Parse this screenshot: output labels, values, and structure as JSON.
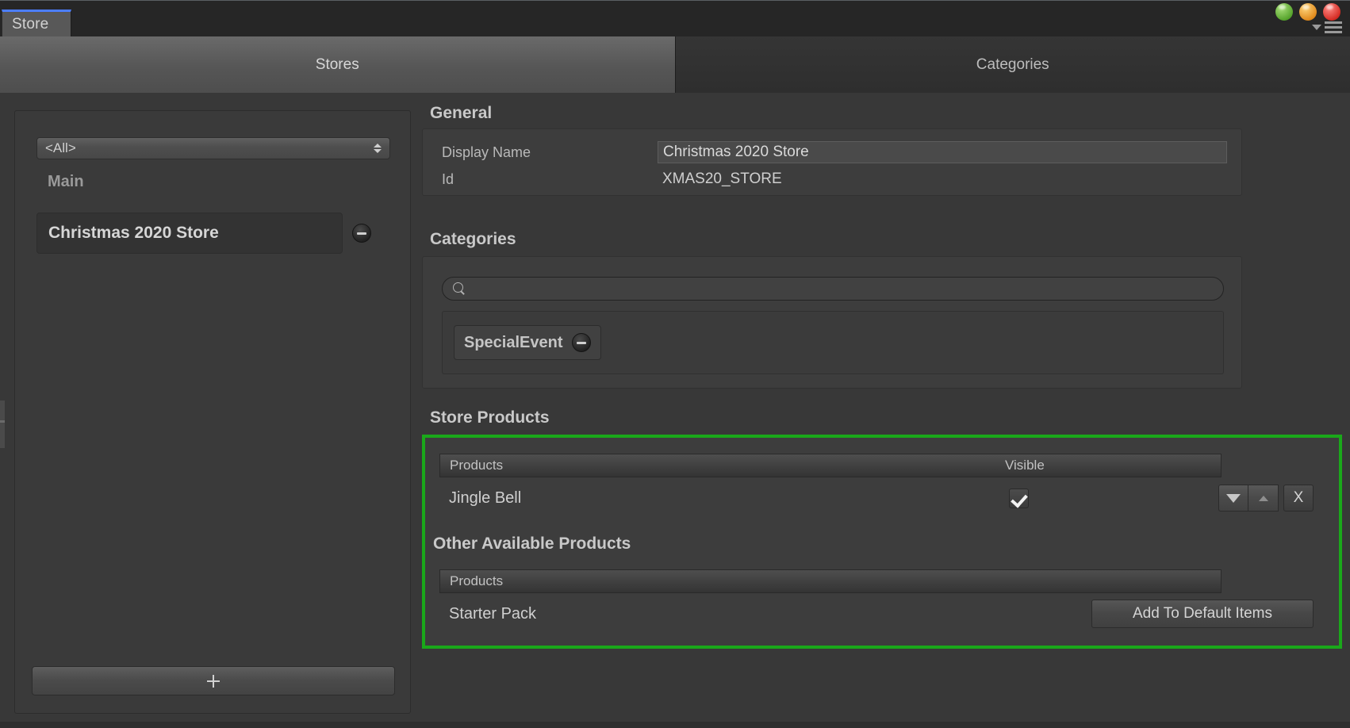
{
  "window": {
    "tab_label": "Store",
    "controls": [
      {
        "name": "minimize-orb",
        "color": "#6cbf3f"
      },
      {
        "name": "maximize-orb",
        "color": "#e5951f"
      },
      {
        "name": "close-orb",
        "color": "#dd2b22"
      }
    ],
    "filter_icon": "filter-icon",
    "menu_icon": "hamburger-menu-icon",
    "accent_color": "#4c7eff"
  },
  "tabs": [
    {
      "label": "Stores",
      "active": true
    },
    {
      "label": "Categories",
      "active": false
    }
  ],
  "sidebar": {
    "filter_dropdown": {
      "value": "<All>",
      "icon": "chevron-updown-icon"
    },
    "group_label": "Main",
    "items": [
      {
        "label": "Christmas 2020 Store",
        "selected": true,
        "remove_icon": "minus-circle-icon"
      }
    ],
    "add_button": {
      "icon": "plus-icon",
      "label": ""
    }
  },
  "general": {
    "title": "General",
    "fields": [
      {
        "label": "Display Name",
        "value": "Christmas 2020 Store",
        "editable": true
      },
      {
        "label": "Id",
        "value": "XMAS20_STORE",
        "editable": false
      }
    ]
  },
  "categories": {
    "title": "Categories",
    "search": {
      "value": "",
      "placeholder": "",
      "icon": "search-icon"
    },
    "chips": [
      {
        "label": "SpecialEvent",
        "remove_icon": "minus-circle-icon"
      }
    ]
  },
  "store_products": {
    "title": "Store Products",
    "highlight_color": "#1aa81a",
    "columns": [
      "Products",
      "Visible"
    ],
    "rows": [
      {
        "name": "Jingle Bell",
        "visible": true,
        "move_down_label": "",
        "move_up_label": "",
        "remove_label": "X"
      }
    ]
  },
  "other_available_products": {
    "title": "Other Available Products",
    "columns": [
      "Products"
    ],
    "rows": [
      {
        "name": "Starter Pack",
        "action_label": "Add To Default Items"
      }
    ]
  }
}
